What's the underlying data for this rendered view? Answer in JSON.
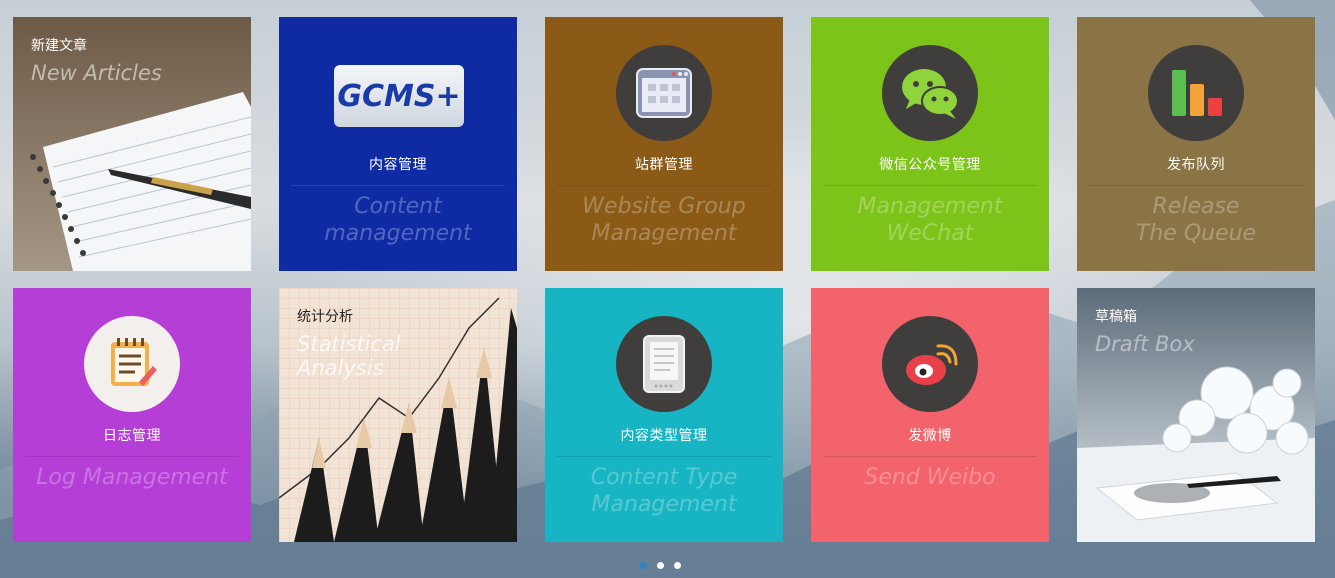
{
  "tiles": [
    {
      "id": "new-articles",
      "cn": "新建文章",
      "en": "New Articles",
      "bg": "#8a7a66"
    },
    {
      "id": "content-management",
      "cn": "内容管理",
      "en": "Content\nmanagement",
      "bg": "#0f2ba3",
      "logo": "GCMS+"
    },
    {
      "id": "website-group",
      "cn": "站群管理",
      "en": "Website Group\nManagement",
      "bg": "#8a5a16"
    },
    {
      "id": "wechat",
      "cn": "微信公众号管理",
      "en": "Management\nWeChat",
      "bg": "#7dc41a"
    },
    {
      "id": "release-queue",
      "cn": "发布队列",
      "en": "Release\nThe Queue",
      "bg": "#8a7445"
    },
    {
      "id": "log-management",
      "cn": "日志管理",
      "en": "Log Management",
      "bg": "#b43ed6"
    },
    {
      "id": "statistical-analysis",
      "cn": "统计分析",
      "en": "Statistical\nAnalysis",
      "bg": "#e2d4c6"
    },
    {
      "id": "content-type",
      "cn": "内容类型管理",
      "en": "Content Type\nManagement",
      "bg": "#17b5c3"
    },
    {
      "id": "send-weibo",
      "cn": "发微博",
      "en": "Send Weibo",
      "bg": "#f3636b"
    },
    {
      "id": "draft-box",
      "cn": "草稿箱",
      "en": "Draft Box",
      "bg": "#6e7d8a"
    }
  ],
  "pager": {
    "count": 3,
    "active": 0
  }
}
